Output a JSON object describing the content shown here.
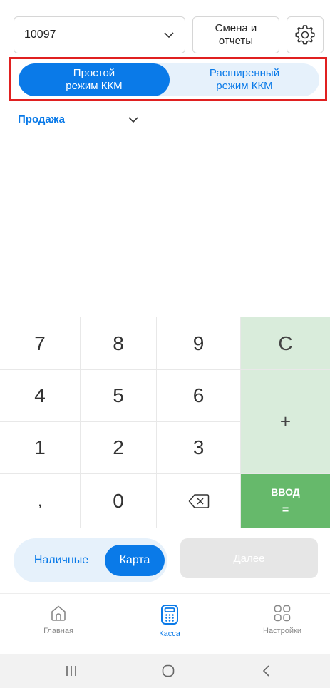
{
  "header": {
    "terminal_value": "10097",
    "shift_button_label": "Смена и\nотчеты",
    "settings_icon": "gear-icon"
  },
  "mode_switch": {
    "simple_label": "Простой\nрежим ККМ",
    "extended_label": "Расширенный\nрежим ККМ",
    "selected": "simple"
  },
  "operation": {
    "label": "Продажа"
  },
  "keypad": {
    "k7": "7",
    "k8": "8",
    "k9": "9",
    "clear": "C",
    "k4": "4",
    "k5": "5",
    "k6": "6",
    "plus": "+",
    "k1": "1",
    "k2": "2",
    "k3": "3",
    "comma": ",",
    "k0": "0",
    "backspace_icon": "backspace-icon",
    "enter_label": "ВВОД",
    "enter_eq": "="
  },
  "payment": {
    "cash_label": "Наличные",
    "card_label": "Карта",
    "selected": "card",
    "next_label": "Далее"
  },
  "bottom_nav": {
    "items": [
      {
        "label": "Главная",
        "icon": "home-icon"
      },
      {
        "label": "Касса",
        "icon": "calculator-icon",
        "active": true
      },
      {
        "label": "Настройки",
        "icon": "grid-icon"
      }
    ]
  },
  "colors": {
    "accent": "#0a7ae8",
    "highlight": "#e02020",
    "keypad_light_green": "#d9ecdb",
    "keypad_green": "#66b96b"
  }
}
